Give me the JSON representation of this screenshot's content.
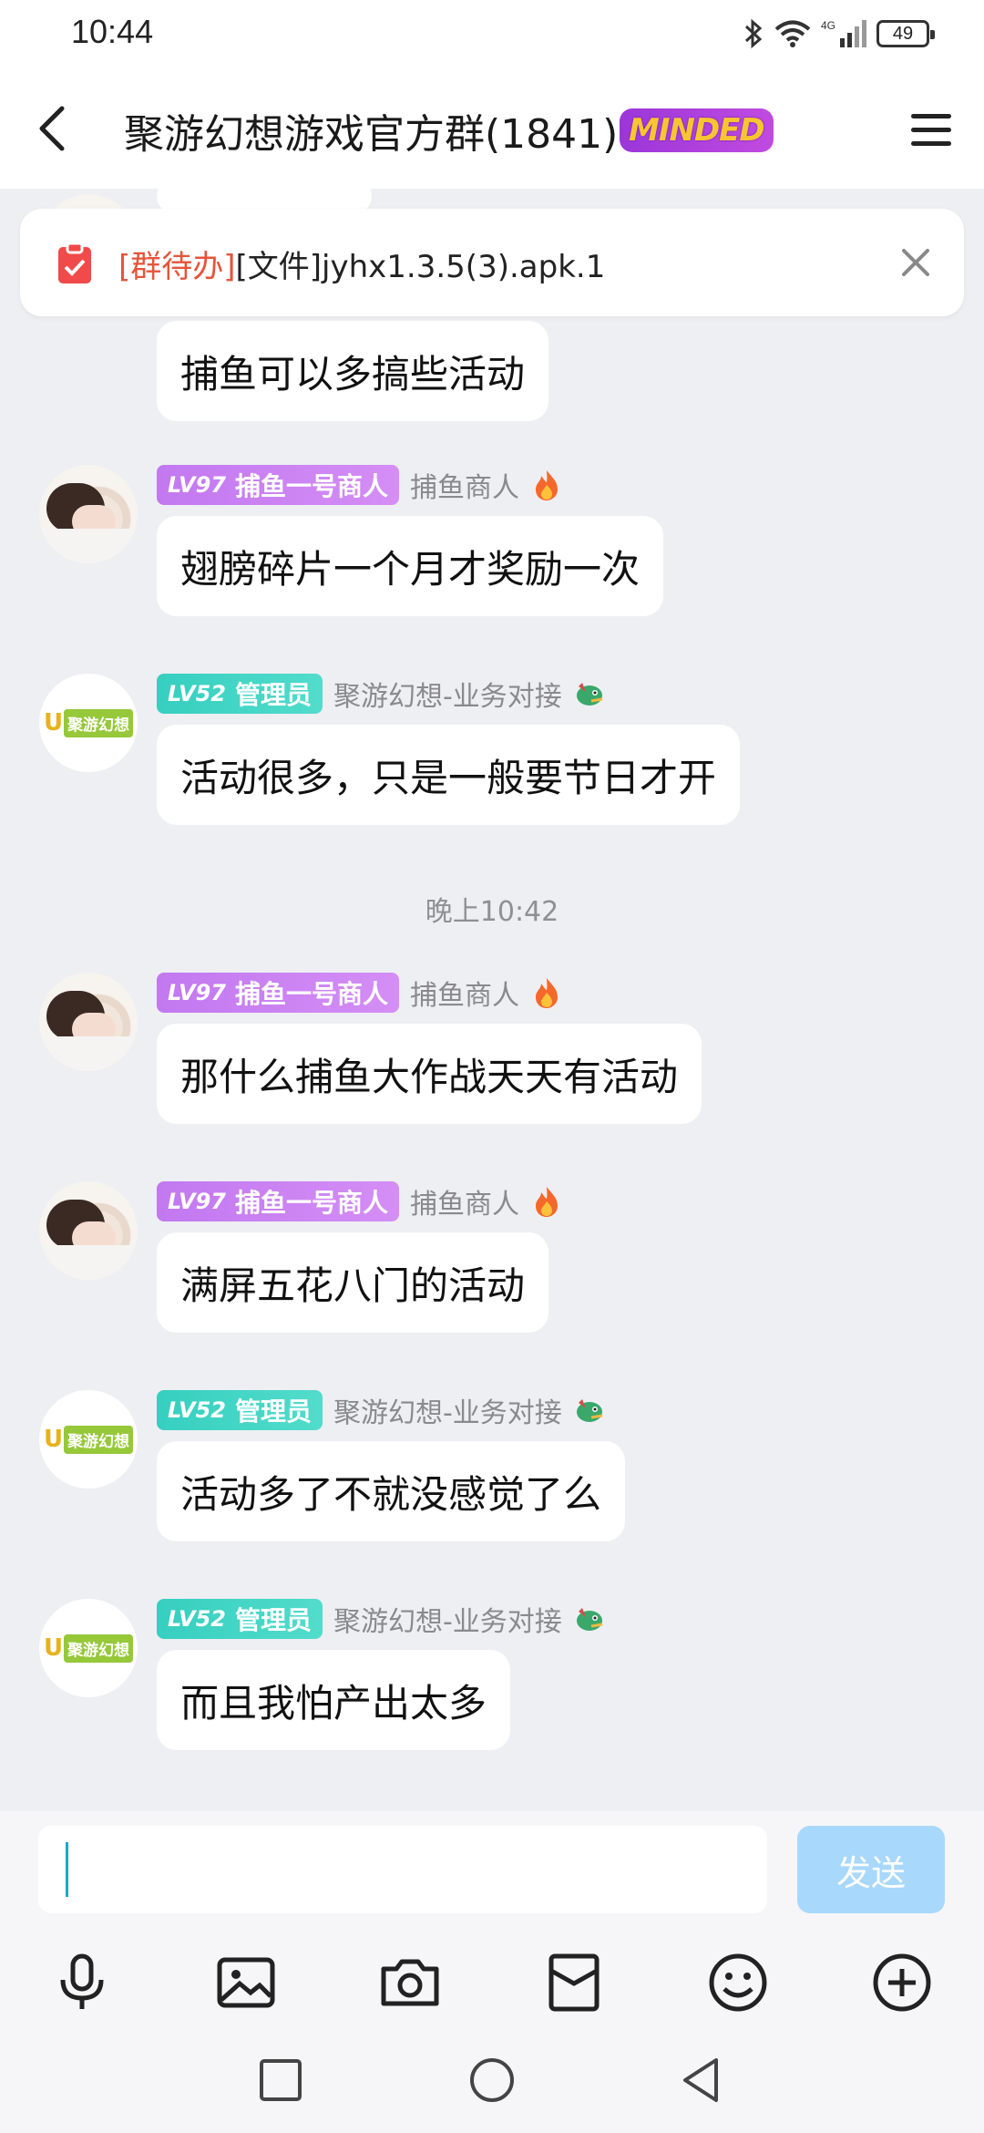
{
  "status_bar": {
    "time": "10:44",
    "battery": "49",
    "network": "4G"
  },
  "header": {
    "title": "聚游幻想游戏官方群(1841)",
    "badge": "MINDED"
  },
  "todo_banner": {
    "tag": "[群待办]",
    "file": "[文件]jyhx1.3.5(3).apk.1"
  },
  "messages": [
    {
      "bubble": "捕鱼可以多搞些活动"
    },
    {
      "level": "LV97",
      "role": "捕鱼一号商人",
      "nick": "捕鱼商人",
      "emoji": "fire-emoji",
      "bubble": "翅膀碎片一个月才奖励一次"
    },
    {
      "level": "LV52",
      "role": "管理员",
      "nick": "聚游幻想-业务对接",
      "emoji": "dragon-emoji",
      "bubble": "活动很多，只是一般要节日才开"
    },
    {
      "level": "LV97",
      "role": "捕鱼一号商人",
      "nick": "捕鱼商人",
      "emoji": "fire-emoji",
      "bubble": "那什么捕鱼大作战天天有活动"
    },
    {
      "level": "LV97",
      "role": "捕鱼一号商人",
      "nick": "捕鱼商人",
      "emoji": "fire-emoji",
      "bubble": "满屏五花八门的活动"
    },
    {
      "level": "LV52",
      "role": "管理员",
      "nick": "聚游幻想-业务对接",
      "emoji": "dragon-emoji",
      "bubble": "活动多了不就没感觉了么"
    },
    {
      "level": "LV52",
      "role": "管理员",
      "nick": "聚游幻想-业务对接",
      "emoji": "dragon-emoji",
      "bubble": "而且我怕产出太多"
    }
  ],
  "time_divider": "晚上10:42",
  "input": {
    "value": "",
    "placeholder": ""
  },
  "send_label": "发送",
  "toolbar_icons": [
    "microphone-icon",
    "image-icon",
    "camera-icon",
    "red-packet-icon",
    "emoji-icon",
    "plus-icon"
  ],
  "nav_icons": [
    "recent-apps-icon",
    "home-icon",
    "back-nav-icon"
  ],
  "colors": {
    "accent_teal": "#36cfc0",
    "accent_purple": "#c278f0",
    "send_disabled": "#a8d8fb",
    "todo_tag": "#e4553a"
  }
}
